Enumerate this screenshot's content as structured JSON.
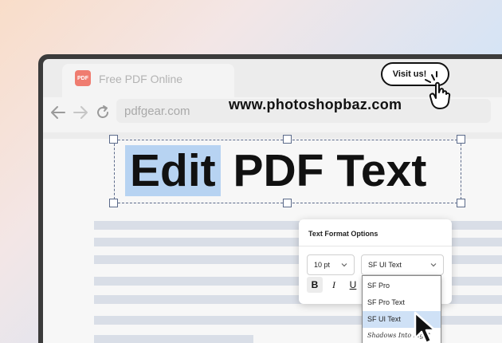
{
  "browser": {
    "tab_title": "Free PDF Online",
    "tab_logo_text": "PDF",
    "url": "pdfgear.com"
  },
  "watermark": "www.photoshopbaz.com",
  "visit_button": "Visit us!",
  "document": {
    "headline_selected": "Edit",
    "headline_rest": " PDF Text"
  },
  "format_panel": {
    "title": "Text Format Options",
    "size_value": "10 pt",
    "font_value": "SF UI Text",
    "bold_label": "B",
    "italic_label": "I",
    "underline_label": "U"
  },
  "font_dropdown": {
    "options": [
      "SF Pro",
      "SF Pro Text",
      "SF UI Text",
      "Shadows Into Light"
    ],
    "selected": "SF UI Text"
  },
  "colors": {
    "selection": "#b7d3f2",
    "handle_border": "#5b6a8a",
    "logo": "#ef7c70"
  }
}
